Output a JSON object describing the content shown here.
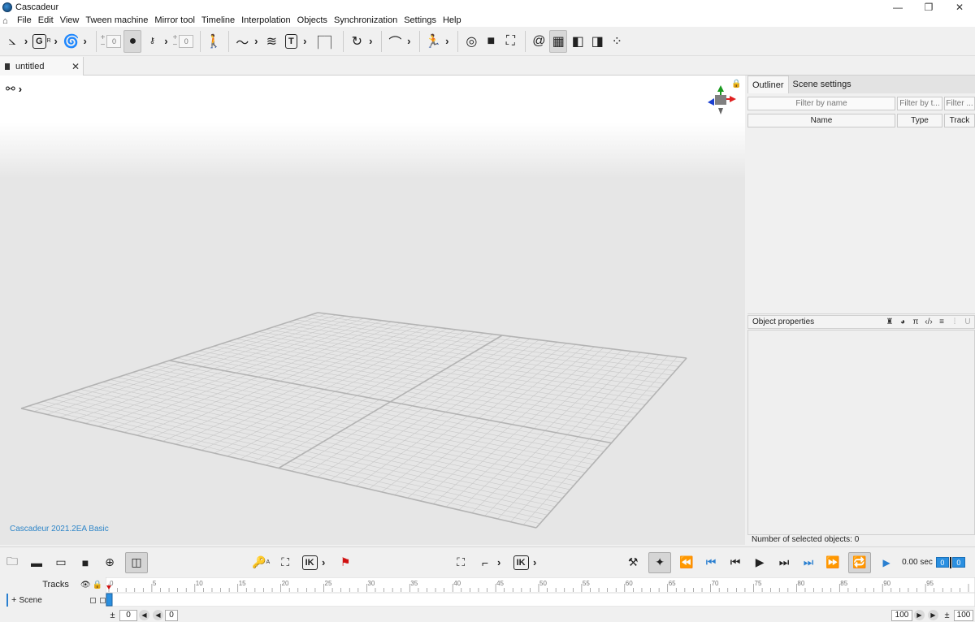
{
  "window": {
    "title": "Cascadeur",
    "controls": [
      "—",
      "❐",
      "✕"
    ]
  },
  "menu": [
    "File",
    "Edit",
    "View",
    "Tween machine",
    "Mirror tool",
    "Timeline",
    "Interpolation",
    "Objects",
    "Synchronization",
    "Settings",
    "Help"
  ],
  "toolbar": {
    "counter_left": "0",
    "counter_right": "0",
    "g_label": "G",
    "g_sup": "R",
    "t_label": "T",
    "wand_sup": "A"
  },
  "tab": {
    "label": "untitled",
    "close": "✕"
  },
  "viewport": {
    "version": "Cascadeur 2021.2EA Basic"
  },
  "outliner": {
    "tabs": [
      "Outliner",
      "Scene settings"
    ],
    "filters": [
      "Filter by name",
      "Filter by t...",
      "Filter ..."
    ],
    "columns": [
      "Name",
      "Type",
      "Track"
    ]
  },
  "object_properties": {
    "title": "Object properties",
    "icons": [
      "♜",
      "◕",
      "π",
      "‹/›",
      "≡",
      "⁞",
      "U"
    ],
    "selected_count": "Number of selected objects: 0"
  },
  "bottom_toolbar": {
    "ik_label": "IK",
    "ik2_label": "IK",
    "wand_sup": "A",
    "time": "0.00 sec",
    "frame_a": "0",
    "frame_b": "0"
  },
  "timeline": {
    "tracks_label": "Tracks",
    "scene_track": "Scene",
    "plus": "+",
    "start": "0",
    "current": "0",
    "end": "100",
    "end2": "100",
    "ticks": [
      "0",
      "5",
      "10",
      "15",
      "20",
      "25",
      "30",
      "35",
      "40",
      "45",
      "50",
      "55",
      "60",
      "65",
      "70",
      "75",
      "80",
      "85",
      "90",
      "95"
    ]
  },
  "colors": {
    "accent_blue": "#2a8fe0",
    "version_text": "#2f86c8",
    "gizmo_red": "#e02020",
    "gizmo_green": "#1a9a20",
    "gizmo_blue": "#1a3fd0",
    "flag_red": "#d01010"
  }
}
